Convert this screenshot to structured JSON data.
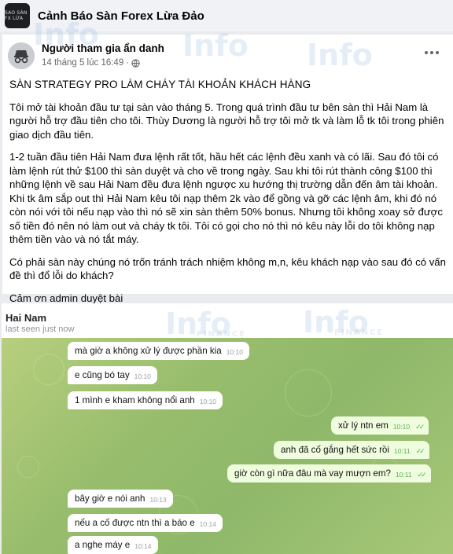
{
  "group": {
    "logo_text": "SAO SÀN FX LỪA",
    "name": "Cảnh Báo Sàn Forex Lừa Đảo"
  },
  "post": {
    "author": "Người tham gia ẩn danh",
    "timestamp": "14 tháng 5 lúc 16:49",
    "separator": "·",
    "title": "SÀN STRATEGY PRO LÀM CHÁY TÀI KHOẢN KHÁCH HÀNG",
    "paragraphs": [
      "Tôi mở tài khoản đầu tư tại sàn vào tháng 5. Trong quá trình đầu tư bên sàn thì Hải Nam là người hỗ trợ đầu tiên cho tôi. Thùy Dương là người hỗ trợ tôi mở tk và làm lỗ tk tôi trong phiên giao dịch đầu tiên.",
      "1-2 tuần đầu tiên Hải Nam đưa lệnh rất tốt, hầu hết các lệnh đều xanh và có lãi. Sau đó tôi có làm lệnh rút thử $100 thì sàn duyệt và cho về trong ngày. Sau khi tôi rút thành công $100 thì những lệnh về sau Hải Nam đều đưa lệnh ngược xu hướng thị trường dẫn đến âm tài khoản. Khi tk âm sắp out thì Hải Nam kêu tôi nạp thêm 2k vào để gồng và gỡ các lệnh âm, khi đó nó còn nói với tôi nếu nạp vào thì nó sẽ xin sàn thêm 50% bonus. Nhưng tôi không xoay sở được số tiền đó nên nó làm out và cháy tk tôi. Tôi có gọi cho nó thì nó kêu này lỗi do tôi không nạp thêm tiền vào và nó tắt máy.",
      "Có phải sàn này chúng nó trốn tránh trách nhiệm không m,n, kêu khách nạp vào sau đó có vấn đề thì đổ lỗi do khách?",
      "Cảm ơn admin duyệt bài"
    ]
  },
  "chat": {
    "name": "Hai Nam",
    "status": "last seen just now",
    "messages": [
      {
        "dir": "in",
        "text": "mà giờ a không xử lý được phần kia",
        "time": "10:10"
      },
      {
        "dir": "in",
        "text": "e cũng bó tay",
        "time": "10:10"
      },
      {
        "dir": "in",
        "text": "1 mình e kham không nổi anh",
        "time": "10:10"
      },
      {
        "dir": "out",
        "text": "xử lý ntn em",
        "time": "10:10"
      },
      {
        "dir": "out",
        "text": "anh đã cố gắng hết sức rồi",
        "time": "10:11"
      },
      {
        "dir": "out",
        "text": "giờ còn gì nữa đâu mà vay mượn em?",
        "time": "10:11"
      },
      {
        "dir": "in",
        "text": "bây giờ e nói anh",
        "time": "10:13"
      },
      {
        "dir": "in",
        "text": "nếu a cố được ntn thì a báo e",
        "time": "10:14"
      },
      {
        "dir": "in",
        "text": "a nghe máy e",
        "time": "10:14"
      }
    ]
  },
  "watermark": {
    "main": "Info",
    "sub": "FINANCE"
  },
  "colors": {
    "chat_bg": "#97bd6c",
    "incoming_bubble": "#ffffff",
    "outgoing_bubble": "#effdde",
    "read_check": "#4fae4e",
    "watermark": "#a0bee1"
  },
  "icons": [
    "globe-icon",
    "more-options-icon",
    "avatar-incognito-icon",
    "double-check-icon"
  ]
}
